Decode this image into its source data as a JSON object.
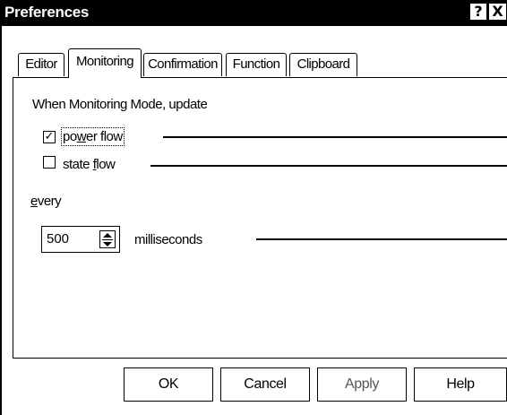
{
  "window": {
    "title": "Preferences",
    "help_glyph": "?",
    "close_glyph": "X"
  },
  "tabs": [
    {
      "label": "Editor"
    },
    {
      "label": "Monitoring",
      "active": true
    },
    {
      "label": "Confirmation"
    },
    {
      "label": "Function"
    },
    {
      "label": "Clipboard"
    }
  ],
  "monitoring": {
    "heading": "When Monitoring Mode, update",
    "power_flow": {
      "label_pre": "po",
      "label_mnemonic": "w",
      "label_post": "er flow",
      "checked": true
    },
    "state_flow": {
      "label_pre": "state ",
      "label_mnemonic": "f",
      "label_post": "low",
      "checked": false
    },
    "every_mnemonic": "e",
    "every_rest": "very",
    "interval_value": "500",
    "interval_unit": "milliseconds"
  },
  "buttons": {
    "ok": "OK",
    "cancel": "Cancel",
    "apply": "Apply",
    "help": "Help"
  },
  "icons": {
    "check": "check-mark-icon",
    "spin_up": "arrow-up-icon",
    "spin_down": "arrow-down-icon"
  }
}
